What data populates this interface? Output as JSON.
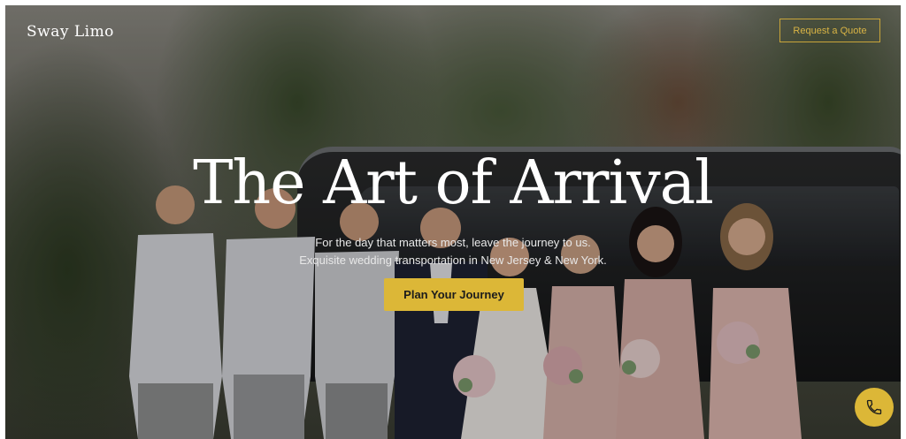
{
  "header": {
    "brand": "Sway Limo",
    "quote_button": "Request a Quote"
  },
  "hero": {
    "title": "The Art of Arrival",
    "subtitle_line1": "For the day that matters most, leave the journey to us.",
    "subtitle_line2": "Exquisite wedding transportation in New Jersey & New York.",
    "cta": "Plan Your Journey"
  },
  "floating": {
    "phone_icon": "phone-icon"
  },
  "colors": {
    "accent": "#dcb737",
    "text": "#ffffff"
  }
}
